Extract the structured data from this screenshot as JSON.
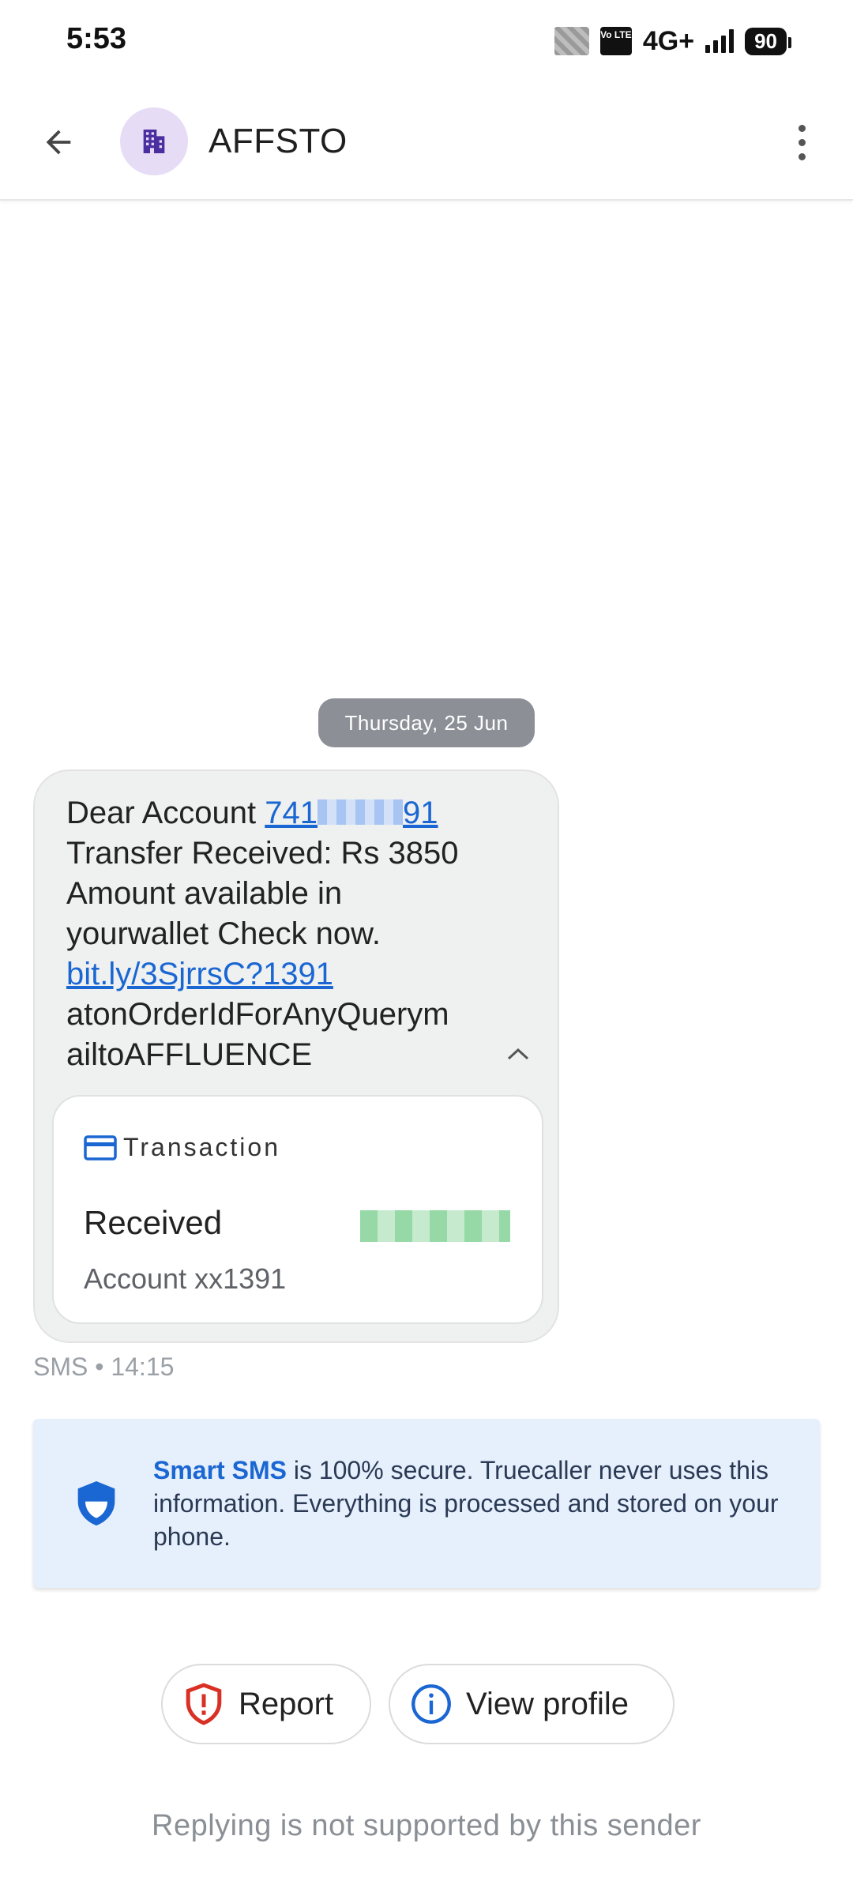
{
  "status_bar": {
    "time": "5:53",
    "volte": "Vo LTE",
    "network": "4G+",
    "battery": "90"
  },
  "header": {
    "title": "AFFSTO",
    "back_icon": "arrow-left-icon",
    "avatar_icon": "building-icon",
    "menu_icon": "more-vert-icon"
  },
  "conversation": {
    "date_chip": "Thursday, 25 Jun",
    "message": {
      "prefix": "Dear Account ",
      "account_link_start": "741",
      "account_link_end": "91",
      "line2": "Transfer Received: Rs 3850",
      "line3": "Amount available in",
      "line4": "yourwallet Check now.",
      "short_link": "bit.ly/3SjrrsC?1391",
      "line6": "atonOrderIdForAnyQuerym",
      "line7": "ailtoAFFLUENCE"
    },
    "transaction_card": {
      "label": "Transaction",
      "status": "Received",
      "account": "Account xx1391"
    },
    "meta_channel": "SMS",
    "meta_separator": "•",
    "meta_time": "14:15"
  },
  "info_banner": {
    "strong": "Smart SMS",
    "text": " is 100% secure. Truecaller never uses this information. Everything is processed and stored on your phone."
  },
  "actions": {
    "report_label": "Report",
    "profile_label": "View profile"
  },
  "footer_note": "Replying is not supported by this sender",
  "colors": {
    "accent": "#1a66d2",
    "chip_bg": "#8c9096",
    "banner_bg": "#e6effc",
    "report_red": "#d93025"
  }
}
